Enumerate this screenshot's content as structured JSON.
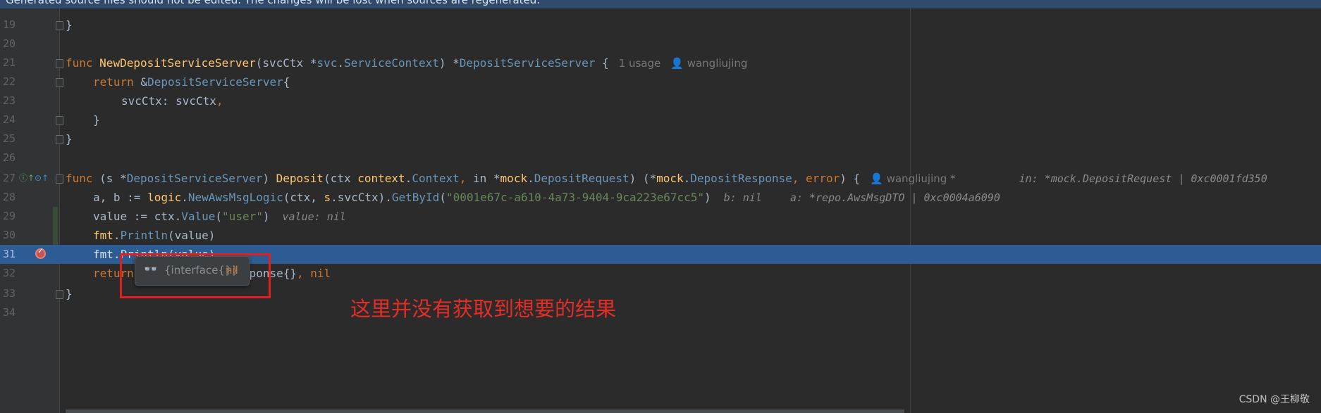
{
  "banner": {
    "text": "Generated source files should not be edited. The changes will be lost when sources are regenerated."
  },
  "editor": {
    "lines": {
      "l19": {
        "num": "19"
      },
      "l20": {
        "num": "20"
      },
      "l21": {
        "num": "21",
        "func_kw": "func",
        "name": "NewDepositServiceServer",
        "p1": "(svcCtx *",
        "pkg": "svc",
        "dot": ".",
        "type1": "ServiceContext",
        "p2": ") *",
        "type2": "DepositServiceServer",
        "p3": " {",
        "usage": "1 usage",
        "author": "wangliujing"
      },
      "l22": {
        "num": "22",
        "kw": "return",
        "amp": " &",
        "type": "DepositServiceServer",
        "brace": "{"
      },
      "l23": {
        "num": "23",
        "field": "svcCtx",
        "colon": ": svcCtx",
        "comma": ","
      },
      "l24": {
        "num": "24",
        "text": "}"
      },
      "l25": {
        "num": "25",
        "text": "}"
      },
      "l26": {
        "num": "26"
      },
      "l27": {
        "num": "27",
        "func_kw": "func",
        "recv": " (s *",
        "recv_type": "DepositServiceServer",
        "close": ") ",
        "name": "Deposit",
        "args1": "(ctx ",
        "ctx_pkg": "context",
        "dot1": ".",
        "ctx_type": "Context",
        "comma1": ", ",
        "in_name": "in *",
        "mock1": "mock",
        "dot2": ".",
        "req_type": "DepositRequest",
        "args2": ") (*",
        "mock2": "mock",
        "dot3": ".",
        "resp_type": "DepositResponse",
        "comma2": ", ",
        "err": "error",
        "tail": ") {",
        "author": "wangliujing *",
        "hint": "in: *mock.DepositRequest | 0xc0001fd350"
      },
      "l28": {
        "num": "28",
        "vars": "a, b := ",
        "pkg": "logic",
        "dot": ".",
        "fn": "NewAwsMsgLogic",
        "args": "(ctx, ",
        "s": "s",
        "svc": ".svcCtx).",
        "method": "GetById",
        "open": "(",
        "str": "\"0001e67c-a610-4a73-9404-9ca223e67cc5\"",
        "close": ")",
        "hint_b": "b: nil",
        "hint_a": "a: *repo.AwsMsgDTO | 0xc0004a6090"
      },
      "l29": {
        "num": "29",
        "code": "value := ctx.",
        "method": "Value",
        "open": "(",
        "str": "\"user\"",
        "close": ")",
        "hint": "value: nil"
      },
      "l30": {
        "num": "30",
        "pkg": "fmt",
        "dot": ".",
        "method": "Println",
        "args": "(value)"
      },
      "l31": {
        "num": "31",
        "code": "fmt.Println(value)"
      },
      "l32": {
        "num": "32",
        "kw": "return",
        "rest": " &mock.DepositResponse",
        "brace": "{}",
        "comma": ", ",
        "nil": "nil"
      },
      "l33": {
        "num": "33",
        "text": "}"
      },
      "l34": {
        "num": "34"
      }
    }
  },
  "tooltip": {
    "type": "{interface{}}",
    "value": "nil",
    "icon": "glasses-icon"
  },
  "annotation": {
    "text": "这里并没有获取到想要的结果"
  },
  "watermark": {
    "text": "CSDN @王柳敬"
  },
  "colors": {
    "keyword": "#cc7832",
    "function": "#ffc66d",
    "type": "#6897bb",
    "string": "#6a8759",
    "exec_line": "#2d5c95",
    "annotation_red": "#e52d26"
  }
}
